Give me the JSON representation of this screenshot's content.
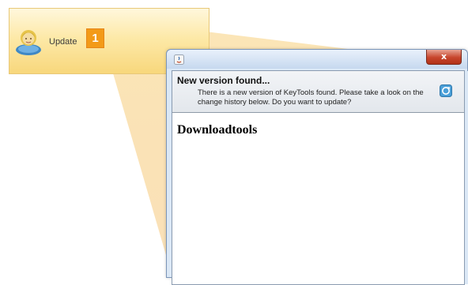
{
  "toolbar": {
    "update_label": "Update",
    "step_number": "1",
    "avatar_icon": "user-avatar-icon"
  },
  "window": {
    "app_icon": "java-icon",
    "close_label": "x",
    "header": {
      "title": "New version found...",
      "message": "There is a new version of KeyTools found. Please take a look on the change history below. Do you want to update?",
      "icon": "update-refresh-icon"
    },
    "content": {
      "heading": "Downloadtools"
    }
  },
  "colors": {
    "highlight": "#fde9a8",
    "badge": "#f39a18",
    "close_button": "#c7452c",
    "window_frame": "#dbe8f6"
  }
}
